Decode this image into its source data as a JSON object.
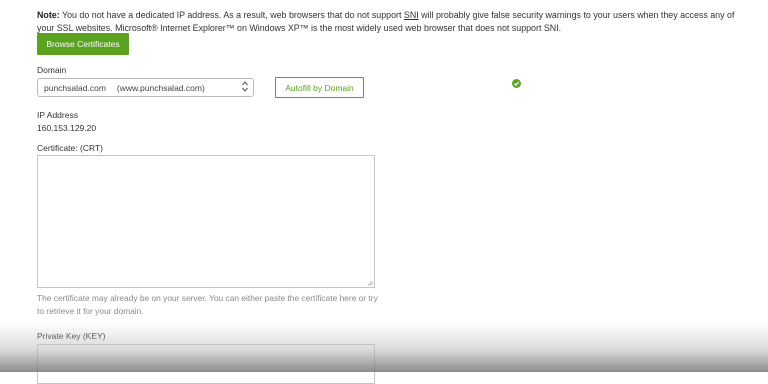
{
  "note": {
    "prefix": "Note:",
    "text_before_link": " You do not have a dedicated IP address. As a result, web browsers that do not support ",
    "link": "SNI",
    "text_after_link": " will probably give false security warnings to your users when they access any of your SSL websites. Microsoft® Internet Explorer™ on Windows XP™ is the most widely used web browser that does not support SNI."
  },
  "browse_button_label": "Browse Certificates",
  "domain": {
    "label": "Domain",
    "selected_domain": "punchsalad.com",
    "selected_alias": "(www.punchsalad.com)",
    "autofill_label": "Autofill by Domain",
    "status_icon": "check-circle-icon",
    "status_color": "#5aa21f"
  },
  "ip": {
    "label": "IP Address",
    "value": "160.153.129.20"
  },
  "certificate": {
    "label": "Certificate: (CRT)",
    "value": "",
    "help": "The certificate may already be on your server. You can either paste the certificate here or try to retrieve it for your domain."
  },
  "private_key": {
    "label": "Private Key (KEY)",
    "value": ""
  },
  "colors": {
    "accent": "#5aa21f",
    "text": "#333333",
    "muted": "#8a8a8a"
  }
}
